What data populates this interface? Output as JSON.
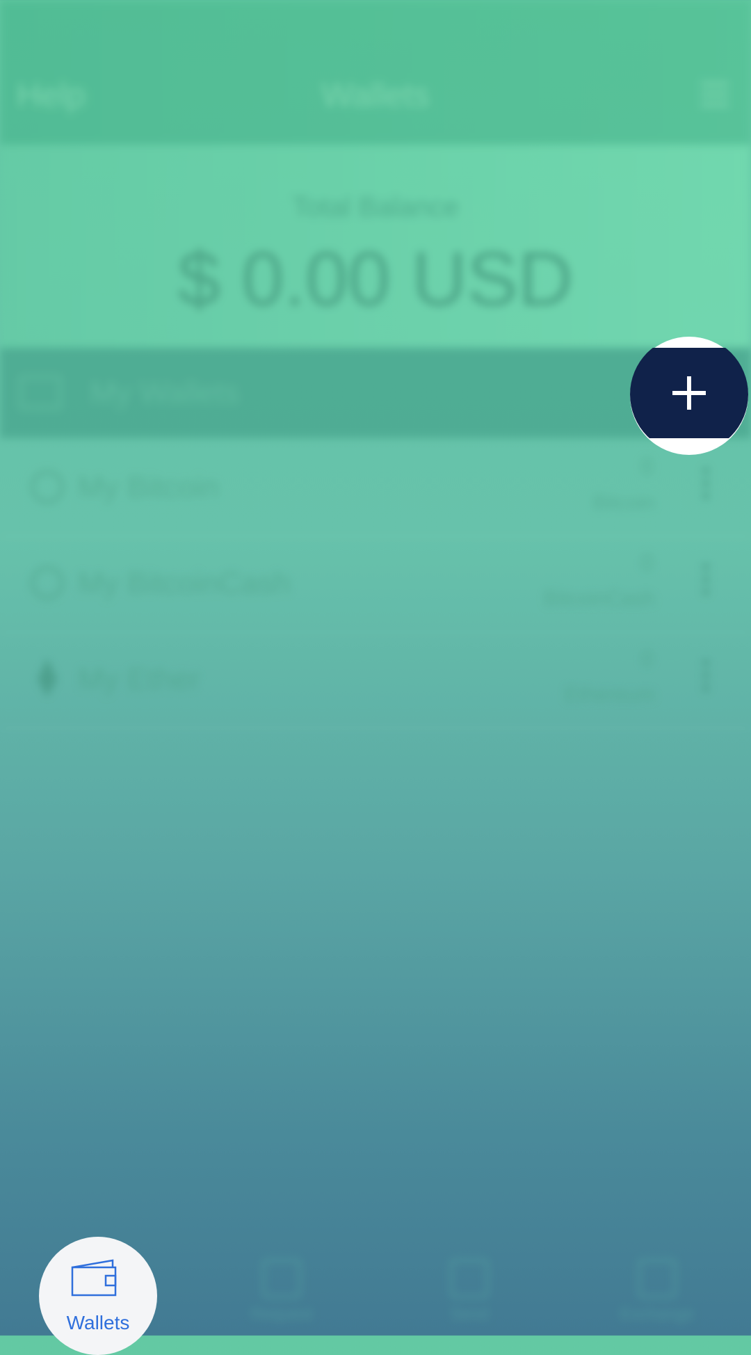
{
  "header": {
    "help_label": "Help",
    "title": "Wallets"
  },
  "balance": {
    "label": "Total Balance",
    "amount": "$ 0.00 USD"
  },
  "wallets_section": {
    "label": "My Wallets"
  },
  "wallets": [
    {
      "name": "My Bitcoin",
      "value": "0",
      "unit": "Bitcoin"
    },
    {
      "name": "My BitcoinCash",
      "value": "0",
      "unit": "BitcoinCash"
    },
    {
      "name": "My Ether",
      "value": "0",
      "unit": "Ethereum"
    }
  ],
  "bottom_nav": [
    {
      "label": "Wallets"
    },
    {
      "label": "Request"
    },
    {
      "label": "Send"
    },
    {
      "label": "Exchange"
    }
  ],
  "colors": {
    "fab": "#10224a",
    "active_label": "#2f6fdc"
  },
  "icons": {
    "fab": "plus-icon",
    "wallet_tab": "wallet-icon"
  }
}
